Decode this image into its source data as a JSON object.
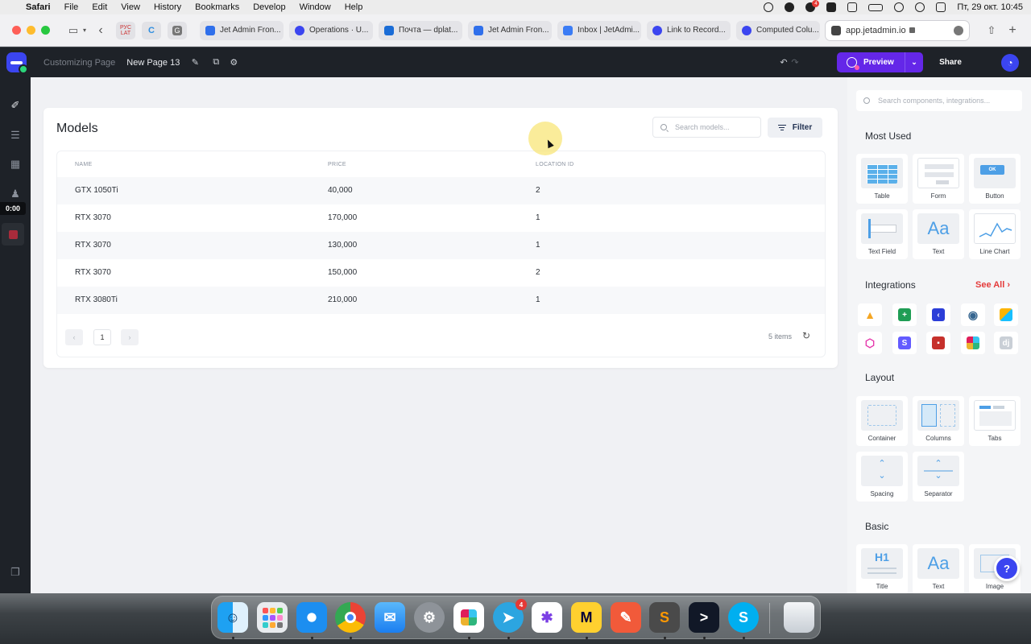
{
  "menubar": {
    "app": "Safari",
    "items": [
      "File",
      "Edit",
      "View",
      "History",
      "Bookmarks",
      "Develop",
      "Window",
      "Help"
    ],
    "notification_count": "4",
    "datetime": "Пт, 29 окт.  10:45"
  },
  "browser": {
    "pinned": [
      "РУС\nLAT",
      "C",
      "G"
    ],
    "tabs": [
      {
        "label": "Jet Admin Fron...",
        "color": "#2f6feb"
      },
      {
        "label": "Operations · U...",
        "color": "#3b45f0"
      },
      {
        "label": "Почта — dplat...",
        "color": "#1a6cd6"
      },
      {
        "label": "Jet Admin Fron...",
        "color": "#2f6feb"
      },
      {
        "label": "Inbox | JetAdmi...",
        "color": "#3b7cf5"
      },
      {
        "label": "Link to Record...",
        "color": "#3b45f0"
      },
      {
        "label": "Computed Colu...",
        "color": "#3b45f0"
      }
    ],
    "address": "app.jetadmin.io"
  },
  "topbar": {
    "crumb": "Customizing Page",
    "page_name": "New Page 13",
    "preview_label": "Preview",
    "share_label": "Share"
  },
  "rail": {
    "timer": "0:00"
  },
  "models": {
    "title": "Models",
    "search_placeholder": "Search models...",
    "filter_label": "Filter",
    "columns": [
      "NAME",
      "PRICE",
      "LOCATION ID"
    ],
    "rows": [
      {
        "name": "GTX 1050Ti",
        "price": "40,000",
        "location": "2"
      },
      {
        "name": "RTX 3070",
        "price": "170,000",
        "location": "1"
      },
      {
        "name": "RTX 3070",
        "price": "130,000",
        "location": "1"
      },
      {
        "name": "RTX 3070",
        "price": "150,000",
        "location": "2"
      },
      {
        "name": "RTX 3080Ti",
        "price": "210,000",
        "location": "1"
      }
    ],
    "page": "1",
    "count": "5 items"
  },
  "panel": {
    "search_placeholder": "Search components, integrations...",
    "most_used": "Most Used",
    "integrations": "Integrations",
    "see_all": "See All",
    "layout": "Layout",
    "basic": "Basic",
    "most_used_tiles": [
      "Table",
      "Form",
      "Button",
      "Text Field",
      "Text",
      "Line Chart"
    ],
    "layout_tiles": [
      "Container",
      "Columns",
      "Tabs",
      "Spacing",
      "Separator"
    ],
    "basic_tiles": [
      "Title",
      "Text",
      "Image"
    ],
    "button_thumb_text": "OK",
    "text_thumb_text": "Aa",
    "title_thumb_text": "H1"
  },
  "dock": {
    "telegram_badge": "4"
  }
}
